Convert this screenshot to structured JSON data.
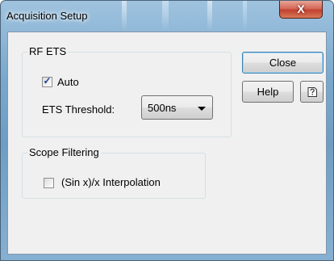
{
  "window": {
    "title": "Acquisition Setup",
    "close_glyph": "X",
    "accent_color": "#6e9dc4"
  },
  "rf_ets": {
    "group_label": "RF ETS",
    "auto_label": "Auto",
    "auto_checked": true,
    "threshold_label": "ETS Threshold:",
    "threshold_value": "500ns"
  },
  "scope_filtering": {
    "group_label": "Scope Filtering",
    "interp_label": "(Sin x)/x Interpolation",
    "interp_checked": false
  },
  "buttons": {
    "close_label": "Close",
    "help_label": "Help",
    "context_help_icon": "context-help-icon"
  }
}
